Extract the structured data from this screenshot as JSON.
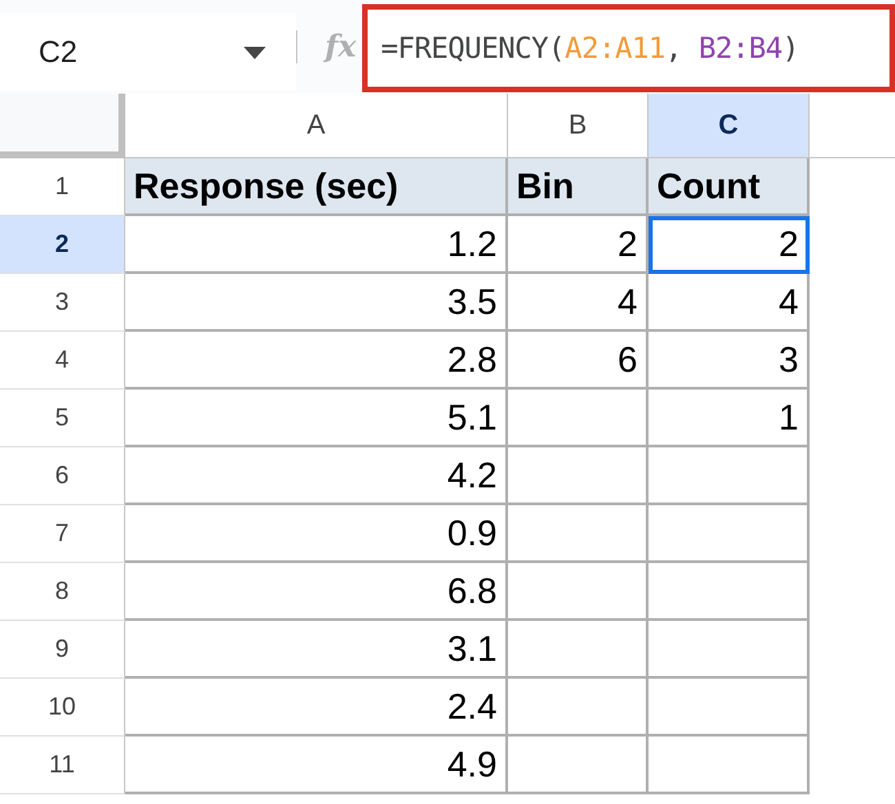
{
  "name_box": {
    "value": "C2"
  },
  "formula_bar": {
    "icon_text": "fx",
    "parts": [
      {
        "text": "=FREQUENCY(",
        "color": "#444746"
      },
      {
        "text": "A2:A11",
        "color": "#f29b39"
      },
      {
        "text": ", ",
        "color": "#444746"
      },
      {
        "text": "B2:B4",
        "color": "#8e44ad"
      },
      {
        "text": ")",
        "color": "#444746"
      }
    ]
  },
  "columns": [
    {
      "label": "A",
      "selected": false
    },
    {
      "label": "B",
      "selected": false
    },
    {
      "label": "C",
      "selected": true
    }
  ],
  "rows": [
    {
      "label": "1",
      "selected": false,
      "cells": [
        {
          "value": "Response (sec)",
          "kind": "header",
          "selected": false
        },
        {
          "value": "Bin",
          "kind": "header",
          "selected": false
        },
        {
          "value": "Count",
          "kind": "header",
          "selected": false
        }
      ]
    },
    {
      "label": "2",
      "selected": true,
      "cells": [
        {
          "value": "1.2",
          "kind": "number",
          "selected": false
        },
        {
          "value": "2",
          "kind": "number",
          "selected": false
        },
        {
          "value": "2",
          "kind": "number",
          "selected": true
        }
      ]
    },
    {
      "label": "3",
      "selected": false,
      "cells": [
        {
          "value": "3.5",
          "kind": "number",
          "selected": false
        },
        {
          "value": "4",
          "kind": "number",
          "selected": false
        },
        {
          "value": "4",
          "kind": "number",
          "selected": false
        }
      ]
    },
    {
      "label": "4",
      "selected": false,
      "cells": [
        {
          "value": "2.8",
          "kind": "number",
          "selected": false
        },
        {
          "value": "6",
          "kind": "number",
          "selected": false
        },
        {
          "value": "3",
          "kind": "number",
          "selected": false
        }
      ]
    },
    {
      "label": "5",
      "selected": false,
      "cells": [
        {
          "value": "5.1",
          "kind": "number",
          "selected": false
        },
        {
          "kind": "number",
          "selected": false
        },
        {
          "value": "1",
          "kind": "number",
          "selected": false
        }
      ]
    },
    {
      "label": "6",
      "selected": false,
      "cells": [
        {
          "value": "4.2",
          "kind": "number",
          "selected": false
        },
        {
          "kind": "number",
          "selected": false
        },
        {
          "kind": "number",
          "selected": false
        }
      ]
    },
    {
      "label": "7",
      "selected": false,
      "cells": [
        {
          "value": "0.9",
          "kind": "number",
          "selected": false
        },
        {
          "kind": "number",
          "selected": false
        },
        {
          "kind": "number",
          "selected": false
        }
      ]
    },
    {
      "label": "8",
      "selected": false,
      "cells": [
        {
          "value": "6.8",
          "kind": "number",
          "selected": false
        },
        {
          "kind": "number",
          "selected": false
        },
        {
          "kind": "number",
          "selected": false
        }
      ]
    },
    {
      "label": "9",
      "selected": false,
      "cells": [
        {
          "value": "3.1",
          "kind": "number",
          "selected": false
        },
        {
          "kind": "number",
          "selected": false
        },
        {
          "kind": "number",
          "selected": false
        }
      ]
    },
    {
      "label": "10",
      "selected": false,
      "cells": [
        {
          "value": "2.4",
          "kind": "number",
          "selected": false
        },
        {
          "kind": "number",
          "selected": false
        },
        {
          "kind": "number",
          "selected": false
        }
      ]
    },
    {
      "label": "11",
      "selected": false,
      "cells": [
        {
          "value": "4.9",
          "kind": "number",
          "selected": false
        },
        {
          "kind": "number",
          "selected": false
        },
        {
          "kind": "number",
          "selected": false
        }
      ]
    }
  ]
}
